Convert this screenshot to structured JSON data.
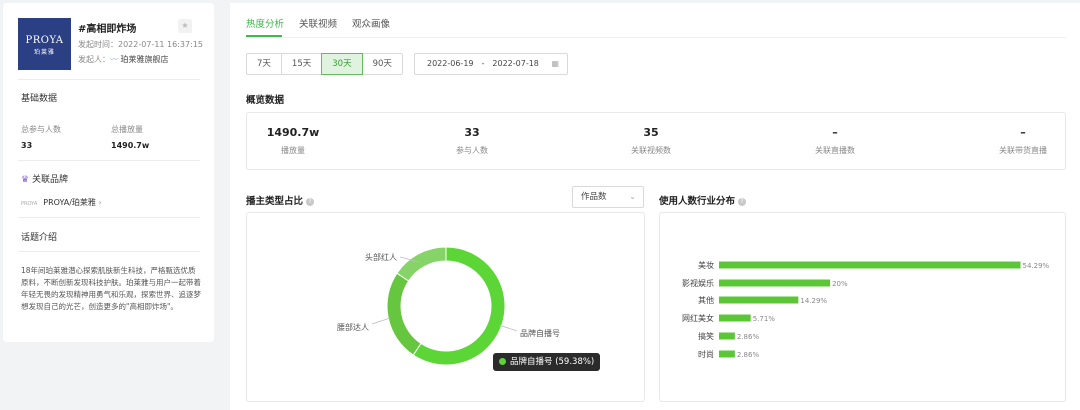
{
  "topic": {
    "logo_line1": "PROYA",
    "logo_line2": "珀莱雅",
    "title": "#高相即炸场",
    "start_time_label": "发起时间：",
    "start_time": "2022-07-11 16:37:15",
    "publisher_label": "发起人：",
    "publisher": "珀莱雅旗舰店"
  },
  "basic": {
    "heading": "基础数据",
    "participants_label": "总参与人数",
    "participants_value": "33",
    "plays_label": "总播放量",
    "plays_value": "1490.7w"
  },
  "brand": {
    "heading": "关联品牌",
    "name": "PROYA/珀莱雅",
    "mini_logo": "PROYA"
  },
  "intro": {
    "heading": "话题介绍",
    "text": "18年间珀莱雅潜心探索肌肤新生科技，严格甄选优质原料，不断创新发现科技护肤。珀莱雅与用户一起带着年轻无畏的发现精神用勇气和乐观，探索世界、追逐梦想发现自己的光芒，创造更多的\"高相即炸场\"。"
  },
  "tabs": [
    "热度分析",
    "关联视频",
    "观众画像"
  ],
  "date_buttons": [
    "7天",
    "15天",
    "30天",
    "90天"
  ],
  "date_range": {
    "start": "2022-06-19",
    "sep": "-",
    "end": "2022-07-18"
  },
  "overview": {
    "heading": "概览数据",
    "items": [
      {
        "value": "1490.7w",
        "label": "播放量"
      },
      {
        "value": "33",
        "label": "参与人数"
      },
      {
        "value": "35",
        "label": "关联视频数"
      },
      {
        "value": "–",
        "label": "关联直播数"
      },
      {
        "value": "–",
        "label": "关联带货直播"
      }
    ]
  },
  "anchor_type": {
    "heading": "播主类型占比",
    "select_value": "作品数",
    "tooltip": "品牌自播号 (59.38%)"
  },
  "industry": {
    "heading": "使用人数行业分布"
  },
  "colors": {
    "accent": "#3eb94d",
    "bar": "#5bc736",
    "donut_main": "#5cd636",
    "donut_2": "#67c640",
    "donut_3": "#86d468"
  },
  "chart_data": [
    {
      "type": "pie",
      "title": "播主类型占比",
      "donut": true,
      "categories": [
        "品牌自播号",
        "腰部达人",
        "头部红人"
      ],
      "values": [
        59.38,
        25.0,
        15.62
      ],
      "unit": "%"
    },
    {
      "type": "bar",
      "orientation": "horizontal",
      "title": "使用人数行业分布",
      "categories": [
        "美妆",
        "影视娱乐",
        "其他",
        "网红美女",
        "搞笑",
        "时尚"
      ],
      "values": [
        54.29,
        20,
        14.29,
        5.71,
        2.86,
        2.86
      ],
      "labels": [
        "54.29%",
        "20%",
        "14.29%",
        "5.71%",
        "2.86%",
        "2.86%"
      ],
      "xlim": [
        0,
        56
      ]
    }
  ]
}
